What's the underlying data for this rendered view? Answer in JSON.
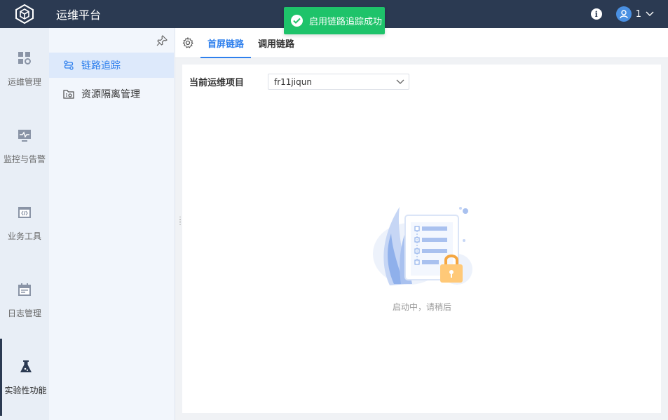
{
  "app": {
    "title": "运维平台"
  },
  "header": {
    "user_name": "1",
    "info_icon": "info-icon",
    "user_icon": "user-icon"
  },
  "toast": {
    "message": "启用链路追踪成功",
    "color": "#1ec36a"
  },
  "rail": {
    "items": [
      {
        "label": "运维管理",
        "icon": "grid-settings-icon"
      },
      {
        "label": "监控与告警",
        "icon": "monitor-icon"
      },
      {
        "label": "业务工具",
        "icon": "code-window-icon"
      },
      {
        "label": "日志管理",
        "icon": "calendar-icon"
      },
      {
        "label": "实验性功能",
        "icon": "flask-icon",
        "active": true
      }
    ]
  },
  "subnav": {
    "items": [
      {
        "label": "链路追踪",
        "icon": "trace-icon",
        "active": true
      },
      {
        "label": "资源隔离管理",
        "icon": "folder-settings-icon"
      }
    ]
  },
  "tabs": [
    {
      "label": "首屏链路",
      "active": true
    },
    {
      "label": "调用链路"
    }
  ],
  "form": {
    "label": "当前运维项目",
    "select_value": "fr11jiqun"
  },
  "empty_state": {
    "text": "启动中，请稍后"
  },
  "colors": {
    "header_bg": "#2b3a52",
    "accent": "#2f80ed"
  }
}
